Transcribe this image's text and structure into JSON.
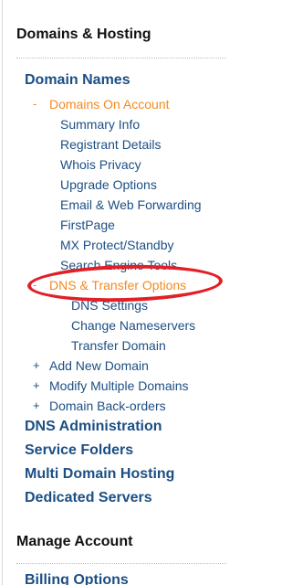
{
  "sidebar": {
    "heading_domains": "Domains & Hosting",
    "domain_names": "Domain Names",
    "domains_on_account": {
      "marker": "-",
      "label": "Domains On Account"
    },
    "items": [
      {
        "label": "Summary Info"
      },
      {
        "label": "Registrant Details"
      },
      {
        "label": "Whois Privacy"
      },
      {
        "label": "Upgrade Options"
      },
      {
        "label": "Email & Web Forwarding"
      },
      {
        "label": "FirstPage"
      },
      {
        "label": "MX Protect/Standby"
      },
      {
        "label": "Search Engine Tools"
      }
    ],
    "dns_transfer": {
      "marker": "-",
      "label": "DNS & Transfer Options"
    },
    "dns_subitems": [
      {
        "label": "DNS Settings"
      },
      {
        "label": "Change Nameservers"
      },
      {
        "label": "Transfer Domain"
      }
    ],
    "expandables": [
      {
        "marker": "+",
        "label": "Add New Domain"
      },
      {
        "marker": "+",
        "label": "Modify Multiple Domains"
      },
      {
        "marker": "+",
        "label": "Domain Back-orders"
      }
    ],
    "top_links": [
      {
        "label": "DNS Administration"
      },
      {
        "label": "Service Folders"
      },
      {
        "label": "Multi Domain Hosting"
      },
      {
        "label": "Dedicated Servers"
      }
    ],
    "heading_account": "Manage Account",
    "billing_options": "Billing Options"
  },
  "colors": {
    "link": "#1c4f84",
    "active": "#f38a1f",
    "heading": "#111111",
    "highlight": "#e21f26"
  },
  "icons": {
    "collapse_marker": "minus-icon",
    "expand_marker": "plus-icon"
  }
}
